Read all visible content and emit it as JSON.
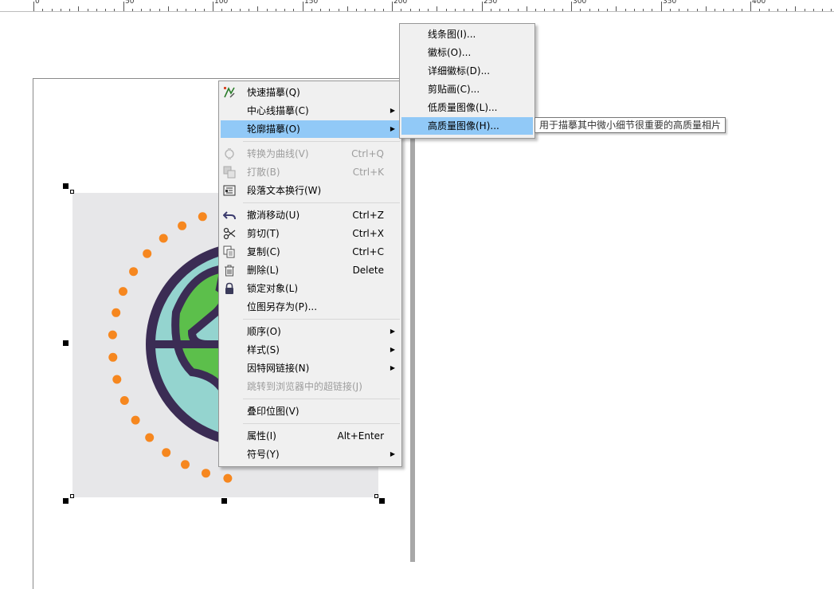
{
  "ruler": {
    "labels": [
      "0",
      "50",
      "100",
      "150",
      "200",
      "250",
      "300",
      "350",
      "400"
    ]
  },
  "context_menu": {
    "items": [
      {
        "label": "快速描摹(Q)",
        "icon": "trace-icon"
      },
      {
        "label": "中心线描摹(C)",
        "has_submenu": true
      },
      {
        "label": "轮廓描摹(O)",
        "has_submenu": true,
        "highlighted": true
      },
      {
        "label": "转换为曲线(V)",
        "shortcut": "Ctrl+Q",
        "disabled": true,
        "icon": "curve-icon"
      },
      {
        "label": "打散(B)",
        "shortcut": "Ctrl+K",
        "disabled": true,
        "icon": "break-apart-icon"
      },
      {
        "label": "段落文本换行(W)",
        "icon": "text-wrap-icon"
      },
      {
        "label": "撤消移动(U)",
        "shortcut": "Ctrl+Z",
        "icon": "undo-icon"
      },
      {
        "label": "剪切(T)",
        "shortcut": "Ctrl+X",
        "icon": "scissors-icon"
      },
      {
        "label": "复制(C)",
        "shortcut": "Ctrl+C",
        "icon": "copy-icon"
      },
      {
        "label": "删除(L)",
        "shortcut": "Delete",
        "icon": "trash-icon"
      },
      {
        "label": "锁定对象(L)",
        "icon": "lock-icon"
      },
      {
        "label": "位图另存为(P)..."
      },
      {
        "label": "顺序(O)",
        "has_submenu": true
      },
      {
        "label": "样式(S)",
        "has_submenu": true
      },
      {
        "label": "因特网链接(N)",
        "has_submenu": true
      },
      {
        "label": "跳转到浏览器中的超链接(J)",
        "disabled": true
      },
      {
        "label": "叠印位图(V)"
      },
      {
        "label": "属性(I)",
        "shortcut": "Alt+Enter"
      },
      {
        "label": "符号(Y)",
        "has_submenu": true
      }
    ],
    "submenu_arrow": "▶"
  },
  "submenu": {
    "items": [
      {
        "label": "线条图(I)..."
      },
      {
        "label": "徽标(O)..."
      },
      {
        "label": "详细徽标(D)..."
      },
      {
        "label": "剪贴画(C)..."
      },
      {
        "label": "低质量图像(L)..."
      },
      {
        "label": "高质量图像(H)...",
        "highlighted": true
      }
    ]
  },
  "tooltip": {
    "text": "用于描摹其中微小细节很重要的高质量相片"
  },
  "colors": {
    "highlight": "#91c9f7",
    "menu_bg": "#f0f0f0",
    "globe_ocean": "#94d4cf",
    "globe_land": "#5cbf4b",
    "globe_outline": "#3b2c54",
    "dots": "#f6871f"
  }
}
